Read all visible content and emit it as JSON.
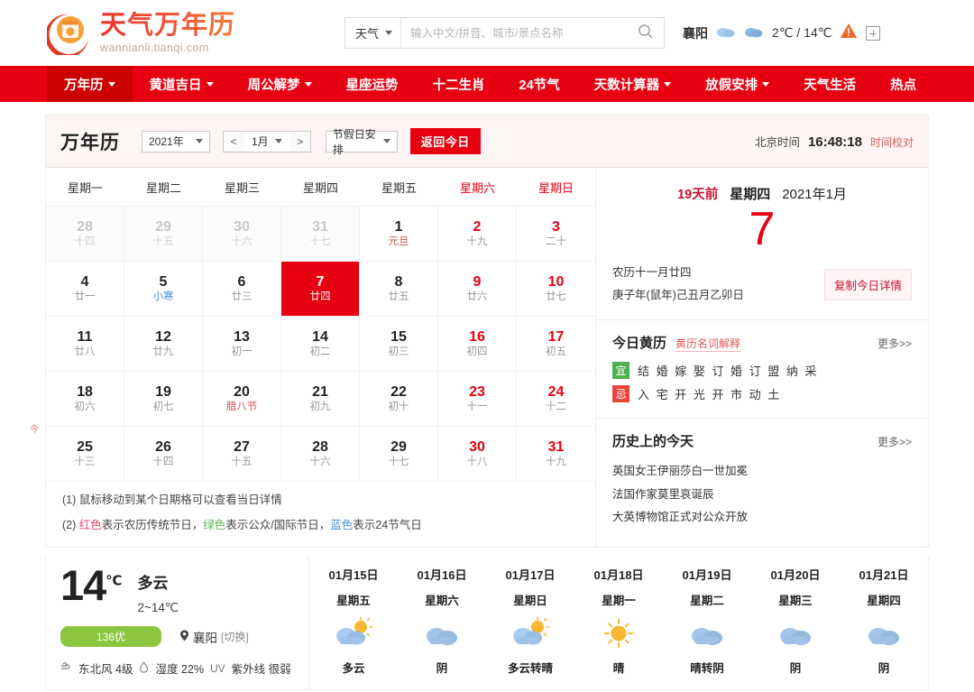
{
  "site": {
    "logo_title": "天气万年历",
    "logo_sub": "wannianli.tianqi.com",
    "logo_icon": "calendar-sun-logo-icon"
  },
  "search": {
    "category": "天气",
    "placeholder": "输入中文/拼音、城市/景点名称",
    "value": "",
    "search_icon": "search-icon"
  },
  "header_weather": {
    "city": "襄阳",
    "icon1": "cloudy-icon",
    "icon2": "cloudy-icon",
    "temp": "2℃ / 14℃",
    "alert_icon": "warning-triangle-icon",
    "add_icon": "plus-box-icon"
  },
  "nav": {
    "items": [
      {
        "label": "万年历",
        "caret": true,
        "active": true
      },
      {
        "label": "黄道吉日",
        "caret": true,
        "active": false
      },
      {
        "label": "周公解梦",
        "caret": true,
        "active": false
      },
      {
        "label": "星座运势",
        "caret": false,
        "active": false
      },
      {
        "label": "十二生肖",
        "caret": false,
        "active": false
      },
      {
        "label": "24节气",
        "caret": false,
        "active": false
      },
      {
        "label": "天数计算器",
        "caret": true,
        "active": false
      },
      {
        "label": "放假安排",
        "caret": true,
        "active": false
      },
      {
        "label": "天气生活",
        "caret": false,
        "active": false
      },
      {
        "label": "热点",
        "caret": false,
        "active": false
      }
    ]
  },
  "calendar_toolbar": {
    "title": "万年历",
    "year": "2021年",
    "prev": "<",
    "month": "1月",
    "next": ">",
    "holiday_select": "节假日安排",
    "today_button": "返回今日",
    "time_label": "北京时间",
    "time_value": "16:48:18",
    "time_check": "时间校对"
  },
  "calendar": {
    "weekdays": [
      {
        "label": "星期一",
        "weekend": false
      },
      {
        "label": "星期二",
        "weekend": false
      },
      {
        "label": "星期三",
        "weekend": false
      },
      {
        "label": "星期四",
        "weekend": false
      },
      {
        "label": "星期五",
        "weekend": false
      },
      {
        "label": "星期六",
        "weekend": true
      },
      {
        "label": "星期日",
        "weekend": true
      }
    ],
    "days": [
      {
        "num": "28",
        "lunar": "十四",
        "gray": true,
        "weekend": false,
        "selected": false,
        "lunar_type": "normal"
      },
      {
        "num": "29",
        "lunar": "十五",
        "gray": true,
        "weekend": false,
        "selected": false,
        "lunar_type": "normal"
      },
      {
        "num": "30",
        "lunar": "十六",
        "gray": true,
        "weekend": false,
        "selected": false,
        "lunar_type": "normal"
      },
      {
        "num": "31",
        "lunar": "十七",
        "gray": true,
        "weekend": false,
        "selected": false,
        "lunar_type": "normal"
      },
      {
        "num": "1",
        "lunar": "元旦",
        "gray": false,
        "weekend": false,
        "selected": false,
        "lunar_type": "fest"
      },
      {
        "num": "2",
        "lunar": "十九",
        "gray": false,
        "weekend": true,
        "selected": false,
        "lunar_type": "normal"
      },
      {
        "num": "3",
        "lunar": "二十",
        "gray": false,
        "weekend": true,
        "selected": false,
        "lunar_type": "normal"
      },
      {
        "num": "4",
        "lunar": "廿一",
        "gray": false,
        "weekend": false,
        "selected": false,
        "lunar_type": "normal"
      },
      {
        "num": "5",
        "lunar": "小寒",
        "gray": false,
        "weekend": false,
        "selected": false,
        "lunar_type": "jq"
      },
      {
        "num": "6",
        "lunar": "廿三",
        "gray": false,
        "weekend": false,
        "selected": false,
        "lunar_type": "normal"
      },
      {
        "num": "7",
        "lunar": "廿四",
        "gray": false,
        "weekend": false,
        "selected": true,
        "lunar_type": "normal"
      },
      {
        "num": "8",
        "lunar": "廿五",
        "gray": false,
        "weekend": false,
        "selected": false,
        "lunar_type": "normal"
      },
      {
        "num": "9",
        "lunar": "廿六",
        "gray": false,
        "weekend": true,
        "selected": false,
        "lunar_type": "normal"
      },
      {
        "num": "10",
        "lunar": "廿七",
        "gray": false,
        "weekend": true,
        "selected": false,
        "lunar_type": "normal"
      },
      {
        "num": "11",
        "lunar": "廿八",
        "gray": false,
        "weekend": false,
        "selected": false,
        "lunar_type": "normal"
      },
      {
        "num": "12",
        "lunar": "廿九",
        "gray": false,
        "weekend": false,
        "selected": false,
        "lunar_type": "normal"
      },
      {
        "num": "13",
        "lunar": "初一",
        "gray": false,
        "weekend": false,
        "selected": false,
        "lunar_type": "normal"
      },
      {
        "num": "14",
        "lunar": "初二",
        "gray": false,
        "weekend": false,
        "selected": false,
        "lunar_type": "normal"
      },
      {
        "num": "15",
        "lunar": "初三",
        "gray": false,
        "weekend": false,
        "selected": false,
        "lunar_type": "normal"
      },
      {
        "num": "16",
        "lunar": "初四",
        "gray": false,
        "weekend": true,
        "selected": false,
        "lunar_type": "normal"
      },
      {
        "num": "17",
        "lunar": "初五",
        "gray": false,
        "weekend": true,
        "selected": false,
        "lunar_type": "normal"
      },
      {
        "num": "18",
        "lunar": "初六",
        "gray": false,
        "weekend": false,
        "selected": false,
        "lunar_type": "normal"
      },
      {
        "num": "19",
        "lunar": "初七",
        "gray": false,
        "weekend": false,
        "selected": false,
        "lunar_type": "normal"
      },
      {
        "num": "20",
        "lunar": "腊八节",
        "gray": false,
        "weekend": false,
        "selected": false,
        "lunar_type": "fest"
      },
      {
        "num": "21",
        "lunar": "初九",
        "gray": false,
        "weekend": false,
        "selected": false,
        "lunar_type": "normal"
      },
      {
        "num": "22",
        "lunar": "初十",
        "gray": false,
        "weekend": false,
        "selected": false,
        "lunar_type": "normal"
      },
      {
        "num": "23",
        "lunar": "十一",
        "gray": false,
        "weekend": true,
        "selected": false,
        "lunar_type": "normal"
      },
      {
        "num": "24",
        "lunar": "十二",
        "gray": false,
        "weekend": true,
        "selected": false,
        "lunar_type": "normal"
      },
      {
        "num": "25",
        "lunar": "十三",
        "gray": false,
        "weekend": false,
        "selected": false,
        "lunar_type": "normal",
        "today_flag": "今"
      },
      {
        "num": "26",
        "lunar": "十四",
        "gray": false,
        "weekend": false,
        "selected": false,
        "lunar_type": "normal"
      },
      {
        "num": "27",
        "lunar": "十五",
        "gray": false,
        "weekend": false,
        "selected": false,
        "lunar_type": "normal"
      },
      {
        "num": "28",
        "lunar": "十六",
        "gray": false,
        "weekend": false,
        "selected": false,
        "lunar_type": "normal"
      },
      {
        "num": "29",
        "lunar": "十七",
        "gray": false,
        "weekend": false,
        "selected": false,
        "lunar_type": "normal"
      },
      {
        "num": "30",
        "lunar": "十八",
        "gray": false,
        "weekend": true,
        "selected": false,
        "lunar_type": "normal"
      },
      {
        "num": "31",
        "lunar": "十九",
        "gray": false,
        "weekend": true,
        "selected": false,
        "lunar_type": "normal"
      }
    ],
    "notes": [
      {
        "prefix": "(1) ",
        "text": "鼠标移动到某个日期格可以查看当日详情"
      },
      {
        "prefix": "(2) ",
        "segments": [
          {
            "text": "红色",
            "color": "red"
          },
          {
            "text": "表示农历传统节日，",
            "color": "plain"
          },
          {
            "text": "绿色",
            "color": "green"
          },
          {
            "text": "表示公众/国际节日，",
            "color": "plain"
          },
          {
            "text": "蓝色",
            "color": "blue"
          },
          {
            "text": "表示24节气日",
            "color": "plain"
          }
        ]
      }
    ]
  },
  "day_panel": {
    "days_ago": "19天前",
    "weekday": "星期四",
    "year_month": "2021年1月",
    "big_day": "7",
    "lunar_line1": "农历十一月廿四",
    "lunar_line2": "庚子年(鼠年)己丑月乙卯日",
    "copy_button": "复制今日详情"
  },
  "almanac": {
    "title": "今日黄历",
    "subtitle": "黄历名词解释",
    "more": "更多>>",
    "yi_badge": "宜",
    "yi_items": "结 婚  嫁 娶  订 婚  订 盟  纳 采",
    "ji_badge": "忌",
    "ji_items": "入 宅  开 光  开 市  动 土"
  },
  "history": {
    "title": "历史上的今天",
    "more": "更多>>",
    "items": [
      "英国女王伊丽莎白一世加冕",
      "法国作家莫里哀诞辰",
      "大英博物馆正式对公众开放"
    ]
  },
  "weather_now": {
    "temp": "14",
    "unit": "℃",
    "desc": "多云",
    "range": "2~14℃",
    "aqi": "136优",
    "city": "襄阳",
    "switch": "[切换]",
    "pin_icon": "location-pin-icon",
    "wind_icon": "wind-icon",
    "wind": "东北风 4级",
    "humidity_icon": "water-drop-icon",
    "humidity": "湿度 22%",
    "uv_label": "UV",
    "uv": "紫外线 很弱"
  },
  "forecast": [
    {
      "date": "01月15日",
      "weekday": "星期五",
      "icon": "partly-cloudy-icon",
      "text": "多云"
    },
    {
      "date": "01月16日",
      "weekday": "星期六",
      "icon": "cloudy-icon",
      "text": "阴"
    },
    {
      "date": "01月17日",
      "weekday": "星期日",
      "icon": "partly-cloudy-icon",
      "text": "多云转晴"
    },
    {
      "date": "01月18日",
      "weekday": "星期一",
      "icon": "sunny-icon",
      "text": "晴"
    },
    {
      "date": "01月19日",
      "weekday": "星期二",
      "icon": "cloudy-icon",
      "text": "晴转阴"
    },
    {
      "date": "01月20日",
      "weekday": "星期三",
      "icon": "cloudy-icon",
      "text": "阴"
    },
    {
      "date": "01月21日",
      "weekday": "星期四",
      "icon": "cloudy-icon",
      "text": "阴"
    }
  ],
  "colors": {
    "brand_red": "#e60012",
    "nav_active": "#cc0000",
    "accent_orange": "#f26522",
    "aqi_green": "#8cc63e",
    "lunar_gray": "#999999"
  }
}
